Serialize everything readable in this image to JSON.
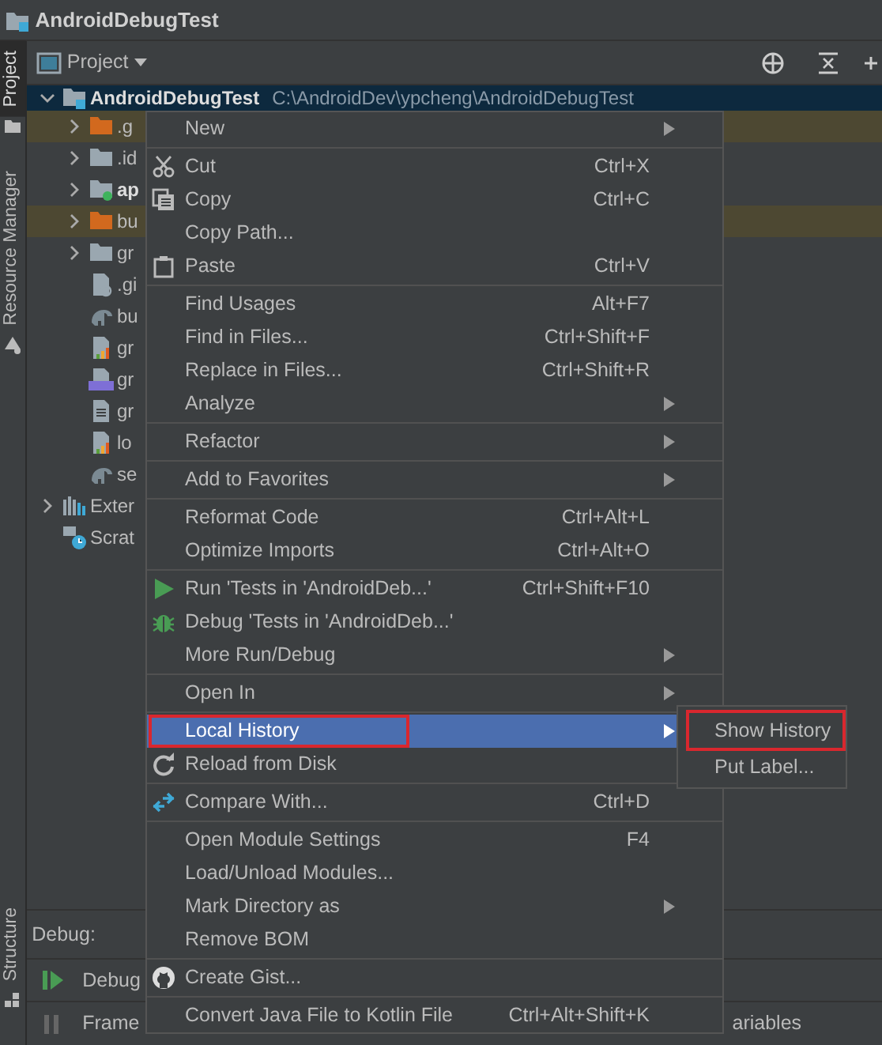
{
  "window": {
    "title": "AndroidDebugTest"
  },
  "tool_strip": {
    "top": [
      {
        "label": "Project",
        "selected": true
      },
      {
        "label": "Resource Manager",
        "selected": false
      }
    ],
    "bottom": [
      {
        "label": "Structure",
        "selected": false
      }
    ]
  },
  "project_panel": {
    "title": "Project"
  },
  "tree": [
    {
      "label": "AndroidDebugTest",
      "path": "C:\\AndroidDev\\ypcheng\\AndroidDebugTest",
      "kind": "module-root",
      "selected": true,
      "expanded": true,
      "children": [
        {
          "label": ".g",
          "kind": "folder",
          "selected": false,
          "excluded": true,
          "expanded": false
        },
        {
          "label": ".id",
          "kind": "folder",
          "selected": false,
          "excluded": false,
          "expanded": false
        },
        {
          "label": "ap",
          "kind": "module",
          "selected": false,
          "excluded": false,
          "expanded": false
        },
        {
          "label": "bu",
          "kind": "folder",
          "selected": false,
          "excluded": true,
          "expanded": false
        },
        {
          "label": "gr",
          "kind": "folder",
          "selected": false,
          "excluded": false,
          "expanded": false
        },
        {
          "label": ".gi",
          "kind": "ignore-file",
          "selected": false
        },
        {
          "label": "bu",
          "kind": "gradle",
          "selected": false
        },
        {
          "label": "gr",
          "kind": "properties",
          "selected": false
        },
        {
          "label": "gr",
          "kind": "cpp",
          "selected": false
        },
        {
          "label": "gr",
          "kind": "text",
          "selected": false
        },
        {
          "label": "lo",
          "kind": "properties",
          "selected": false
        },
        {
          "label": "se",
          "kind": "gradle",
          "selected": false
        }
      ]
    },
    {
      "label": "Exter",
      "kind": "library",
      "selected": false,
      "expanded": false
    },
    {
      "label": "Scrat",
      "kind": "scratch",
      "selected": false
    }
  ],
  "context_menu": {
    "groups": [
      [
        {
          "label": "New",
          "submenu": true
        }
      ],
      [
        {
          "label": "Cut",
          "kind": "cut",
          "shortcut": "Ctrl+X"
        },
        {
          "label": "Copy",
          "kind": "copy",
          "shortcut": "Ctrl+C"
        },
        {
          "label": "Copy Path..."
        },
        {
          "label": "Paste",
          "kind": "paste",
          "shortcut": "Ctrl+V"
        }
      ],
      [
        {
          "label": "Find Usages",
          "shortcut": "Alt+F7"
        },
        {
          "label": "Find in Files...",
          "shortcut": "Ctrl+Shift+F"
        },
        {
          "label": "Replace in Files...",
          "shortcut": "Ctrl+Shift+R"
        },
        {
          "label": "Analyze",
          "submenu": true
        }
      ],
      [
        {
          "label": "Refactor",
          "submenu": true
        }
      ],
      [
        {
          "label": "Add to Favorites",
          "submenu": true
        }
      ],
      [
        {
          "label": "Reformat Code",
          "shortcut": "Ctrl+Alt+L"
        },
        {
          "label": "Optimize Imports",
          "shortcut": "Ctrl+Alt+O"
        }
      ],
      [
        {
          "label": "Run 'Tests in 'AndroidDeb...'",
          "kind": "run",
          "shortcut": "Ctrl+Shift+F10"
        },
        {
          "label": "Debug 'Tests in 'AndroidDeb...'",
          "kind": "debug"
        },
        {
          "label": "More Run/Debug",
          "submenu": true
        }
      ],
      [
        {
          "label": "Open In",
          "submenu": true
        }
      ],
      [
        {
          "label": "Local History",
          "submenu": true,
          "selected": true,
          "annotated": true
        },
        {
          "label": "Reload from Disk",
          "kind": "reload"
        }
      ],
      [
        {
          "label": "Compare With...",
          "kind": "compare",
          "shortcut": "Ctrl+D"
        }
      ],
      [
        {
          "label": "Open Module Settings",
          "shortcut": "F4"
        },
        {
          "label": "Load/Unload Modules..."
        },
        {
          "label": "Mark Directory as",
          "submenu": true
        },
        {
          "label": "Remove BOM"
        }
      ],
      [
        {
          "label": "Create Gist...",
          "kind": "github"
        }
      ],
      [
        {
          "label": "Convert Java File to Kotlin File",
          "shortcut": "Ctrl+Alt+Shift+K"
        }
      ]
    ]
  },
  "submenu": {
    "items": [
      {
        "label": "Show History",
        "annotated": true
      },
      {
        "label": "Put Label..."
      }
    ]
  },
  "debug_panel": {
    "title": "Debug:",
    "tab": "Debug",
    "frames_header": "Frame",
    "variables_header": "ariables"
  }
}
